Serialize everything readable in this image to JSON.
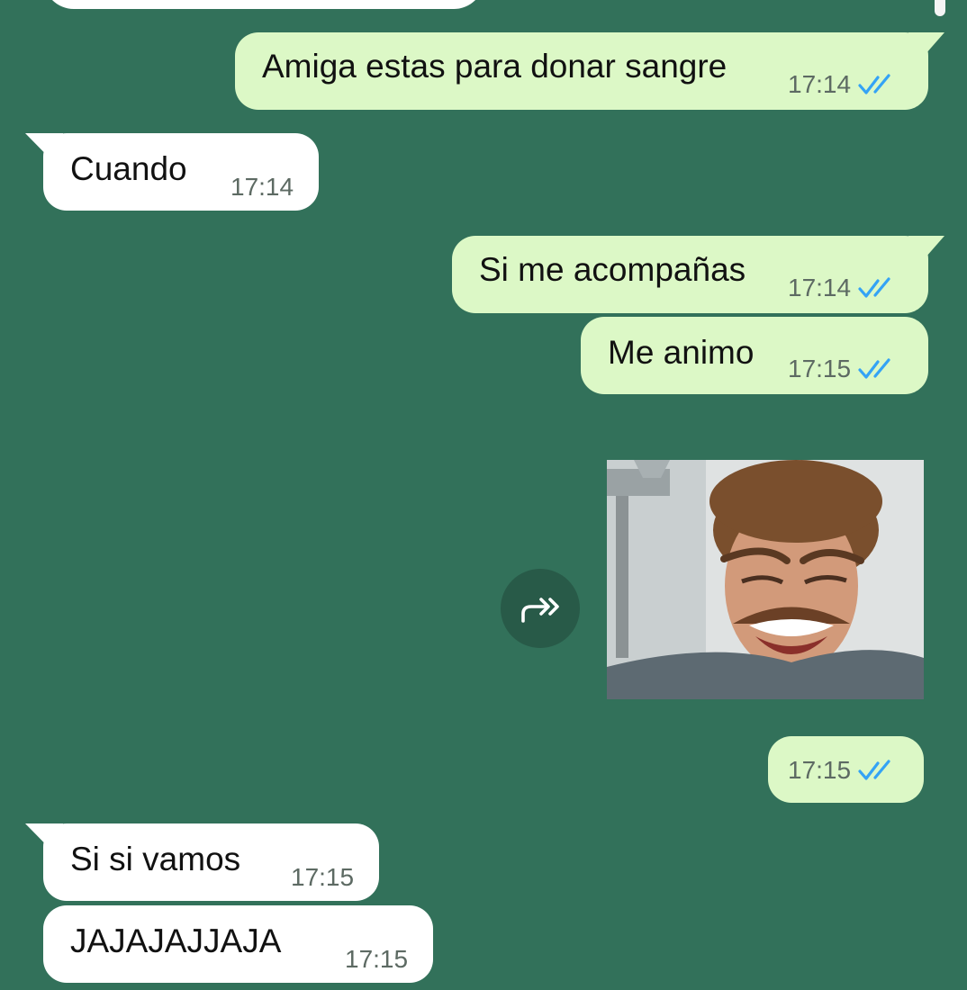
{
  "messages": [
    {
      "type": "text",
      "direction": "outgoing",
      "text": "Amiga estas para donar sangre",
      "time": "17:14",
      "status": "read"
    },
    {
      "type": "text",
      "direction": "incoming",
      "text": "Cuando",
      "time": "17:14"
    },
    {
      "type": "text",
      "direction": "outgoing",
      "text": "Si me acompañas",
      "time": "17:14",
      "status": "read"
    },
    {
      "type": "text",
      "direction": "outgoing",
      "text": "Me animo",
      "time": "17:15",
      "status": "read"
    },
    {
      "type": "sticker",
      "direction": "outgoing",
      "description": "crying-man-sticker"
    },
    {
      "type": "timestamp-only",
      "direction": "outgoing",
      "time": "17:15",
      "status": "read"
    },
    {
      "type": "text",
      "direction": "incoming",
      "text": "Si si vamos",
      "time": "17:15"
    },
    {
      "type": "text",
      "direction": "incoming",
      "text": "JAJAJAJJAJA",
      "time": "17:15"
    }
  ],
  "colors": {
    "background": "#32715a",
    "outgoing_bubble": "#dcf8c6",
    "incoming_bubble": "#ffffff",
    "read_tick": "#34a3f5",
    "forward_button": "#285a48"
  },
  "icons": {
    "read_receipt": "double-check-icon",
    "forward": "forward-icon"
  }
}
